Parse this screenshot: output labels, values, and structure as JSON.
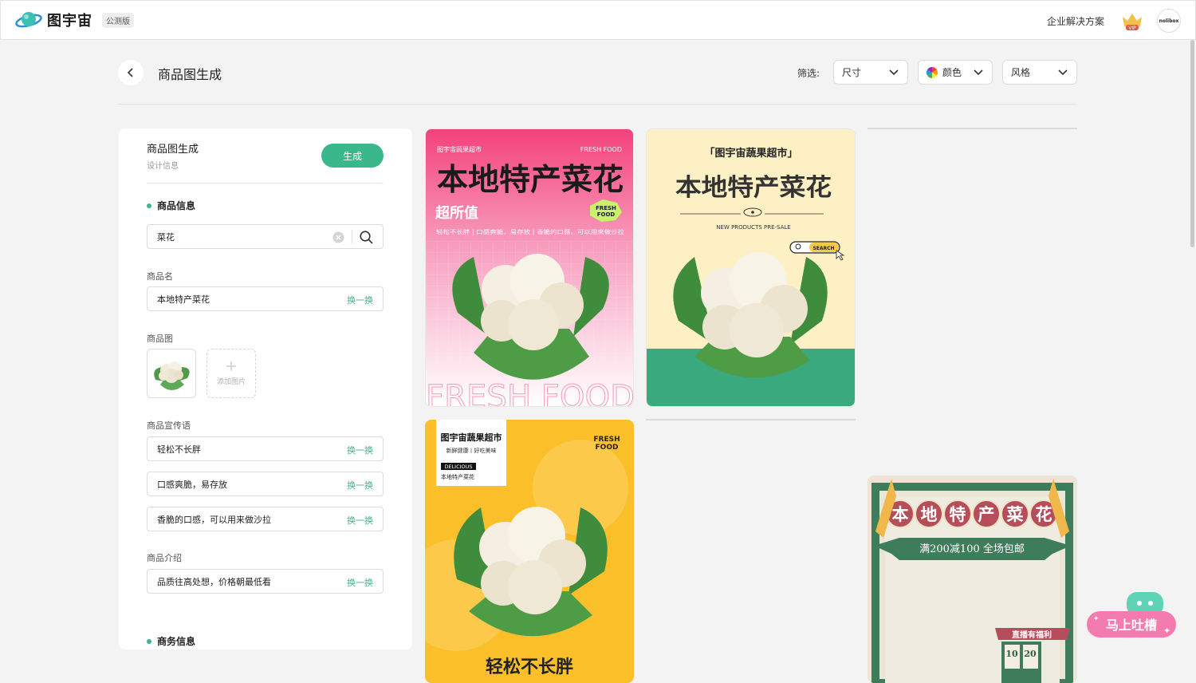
{
  "app": {
    "name": "图宇宙",
    "badge": "公测版"
  },
  "topbar": {
    "enterprise_link": "企业解决方案",
    "vip_label": "VIP",
    "avatar_text": "nolibox"
  },
  "header": {
    "title": "商品图生成",
    "filter_label": "筛选:",
    "filters": [
      "尺寸",
      "颜色",
      "风格"
    ]
  },
  "panel": {
    "title": "商品图生成",
    "subtitle": "设计信息",
    "generate_label": "生成",
    "product_info_title": "商品信息",
    "search_value": "菜花",
    "name_label": "商品名",
    "name_value": "本地特产菜花",
    "swap_label": "换一换",
    "image_label": "商品图",
    "add_image_label": "添加图片",
    "slogan_label": "商品宣传语",
    "slogans": [
      "轻松不长胖",
      "口感爽脆，易存放",
      "香脆的口感，可以用来做沙拉"
    ],
    "intro_label": "商品介绍",
    "intro_value": "品质往高处想，价格朝最低看",
    "business_title": "商务信息"
  },
  "card1": {
    "store": "图宇宙蔬果超市",
    "tag": "FRESH FOOD",
    "headline": "本地特产菜花",
    "sub": "超所值",
    "badge": "FRESH\nFOOD",
    "desc": "轻松不长胖 | 口感爽脆，易存放 | 香脆的口感，可以用来做沙拉",
    "watermark": "FRESH FOOD"
  },
  "card2": {
    "store": "「图宇宙蔬果超市」",
    "headline": "本地特产菜花",
    "presale": "NEW PRODUCTS PRE-SALE",
    "search": "SEARCH"
  },
  "card3": {
    "store": "图宇宙蔬果超市",
    "tagline": "新鲜健康丨好吃美味",
    "delicious": "DELICIOUS",
    "product": "本地特产菜花",
    "tag": "FRESH\nFOOD",
    "headline": "轻松不长胖"
  },
  "card4": {
    "chars": [
      "本",
      "地",
      "特",
      "产",
      "菜",
      "花"
    ],
    "banner": "满200减100 全场包邮",
    "live": "直播有福利",
    "dates": [
      "10",
      "20"
    ]
  },
  "feedback": {
    "label": "马上吐槽"
  },
  "colors": {
    "accent": "#3bb78c",
    "card1_top": "#f4427b",
    "card2_bg": "#fdf0c4",
    "card2_green": "#3aa97d",
    "card3_bg": "#fbbf2a",
    "card4_green": "#3e7d5c",
    "card4_red": "#b64d5a"
  }
}
